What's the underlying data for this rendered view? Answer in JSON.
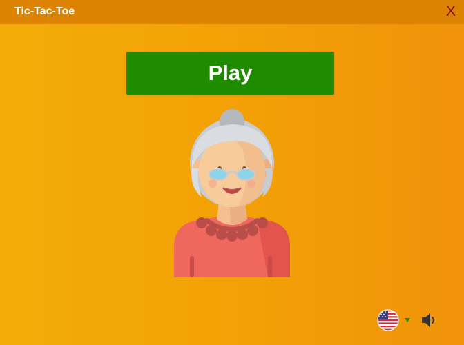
{
  "window": {
    "title": "Tic-Tac-Toe",
    "close_label": "X"
  },
  "main": {
    "play_label": "Play",
    "avatar_icon": "grandmother-avatar"
  },
  "footer": {
    "language_icon": "us-flag-icon",
    "language_menu_icon": "caret-down-icon",
    "sound_icon": "speaker-icon"
  },
  "colors": {
    "background": "#f3a106",
    "titlebar": "#dc8401",
    "play_button": "#1f8c00",
    "close_x": "#8b0a0a"
  }
}
